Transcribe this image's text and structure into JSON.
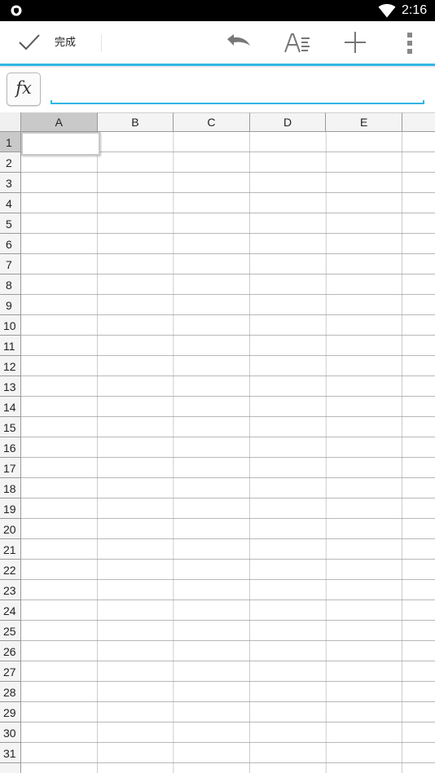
{
  "status_bar": {
    "time": "2:16",
    "icons": [
      "shield-icon",
      "wifi-icon"
    ]
  },
  "action_bar": {
    "done_label": "完成",
    "done_icon": "check-icon",
    "actions": [
      {
        "name": "undo-button",
        "icon": "undo-icon"
      },
      {
        "name": "format-button",
        "icon": "text-format-icon"
      },
      {
        "name": "insert-button",
        "icon": "plus-icon"
      },
      {
        "name": "more-button",
        "icon": "overflow-menu-icon"
      }
    ],
    "accent_color": "#33b5e5"
  },
  "formula_bar": {
    "fx_label": "fx",
    "value": "",
    "placeholder": ""
  },
  "sheet": {
    "columns": [
      "A",
      "B",
      "C",
      "D",
      "E"
    ],
    "rows": [
      "1",
      "2",
      "3",
      "4",
      "5",
      "6",
      "7",
      "8",
      "9",
      "10",
      "11",
      "12",
      "13",
      "14",
      "15",
      "16",
      "17",
      "18",
      "19",
      "20",
      "21",
      "22",
      "23",
      "24",
      "25",
      "26",
      "27",
      "28",
      "29",
      "30",
      "31"
    ],
    "selected_cell": "A1",
    "selected_column": "A",
    "selected_row": "1"
  }
}
